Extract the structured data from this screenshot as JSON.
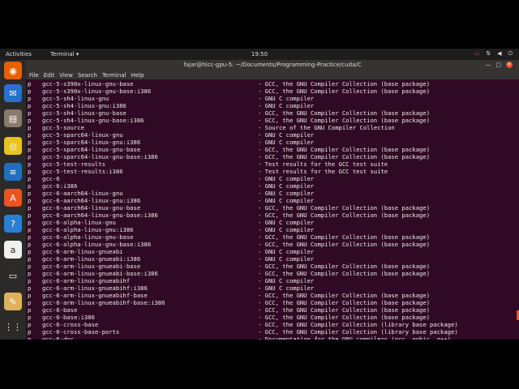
{
  "topbar": {
    "activities": "Activities",
    "app_menu": "Terminal ▾",
    "clock": "19:50",
    "tray_icons": [
      "record-icon",
      "network-icon",
      "volume-icon",
      "power-icon"
    ]
  },
  "dock": {
    "items": [
      {
        "name": "firefox-icon",
        "glyph": "◉",
        "color": "#e66000"
      },
      {
        "name": "thunderbird-icon",
        "glyph": "✉",
        "color": "#2a6fcf"
      },
      {
        "name": "files-icon",
        "glyph": "▤",
        "color": "#8a7a6a"
      },
      {
        "name": "rhythmbox-icon",
        "glyph": "◎",
        "color": "#e8c320"
      },
      {
        "name": "writer-icon",
        "glyph": "≡",
        "color": "#1e6fc2"
      },
      {
        "name": "software-center-icon",
        "glyph": "A",
        "color": "#e95420"
      },
      {
        "name": "help-icon",
        "glyph": "?",
        "color": "#2a7fd4"
      },
      {
        "name": "amazon-icon",
        "glyph": "a",
        "color": "#f0f0f0"
      },
      {
        "name": "terminal-icon",
        "glyph": "▭",
        "color": "#2b2b2b"
      },
      {
        "name": "text-editor-icon",
        "glyph": "✎",
        "color": "#e0b060"
      },
      {
        "name": "show-apps-icon",
        "glyph": "⋮⋮",
        "color": "#2c2a29"
      }
    ]
  },
  "window": {
    "title": "fajar@hicc-gpu-5: ~/Documents/Programming-Practice/cuda/C",
    "menu": [
      "File",
      "Edit",
      "View",
      "Search",
      "Terminal",
      "Help"
    ]
  },
  "terminal": {
    "rows": [
      {
        "flag": "p",
        "pkg": "gcc-5-s390x-linux-gnu-base",
        "desc": "- GCC, the GNU Compiler Collection (base package)"
      },
      {
        "flag": "p",
        "pkg": "gcc-5-s390x-linux-gnu-base:i386",
        "desc": "- GCC, the GNU Compiler Collection (base package)"
      },
      {
        "flag": "p",
        "pkg": "gcc-5-sh4-linux-gnu",
        "desc": "- GNU C compiler"
      },
      {
        "flag": "p",
        "pkg": "gcc-5-sh4-linux-gnu:i386",
        "desc": "- GNU C compiler"
      },
      {
        "flag": "p",
        "pkg": "gcc-5-sh4-linux-gnu-base",
        "desc": "- GCC, the GNU Compiler Collection (base package)"
      },
      {
        "flag": "p",
        "pkg": "gcc-5-sh4-linux-gnu-base:i386",
        "desc": "- GCC, the GNU Compiler Collection (base package)"
      },
      {
        "flag": "p",
        "pkg": "gcc-5-source",
        "desc": "- Source of the GNU Compiler Collection"
      },
      {
        "flag": "p",
        "pkg": "gcc-5-sparc64-linux-gnu",
        "desc": "- GNU C compiler"
      },
      {
        "flag": "p",
        "pkg": "gcc-5-sparc64-linux-gnu:i386",
        "desc": "- GNU C compiler"
      },
      {
        "flag": "p",
        "pkg": "gcc-5-sparc64-linux-gnu-base",
        "desc": "- GCC, the GNU Compiler Collection (base package)"
      },
      {
        "flag": "p",
        "pkg": "gcc-5-sparc64-linux-gnu-base:i386",
        "desc": "- GCC, the GNU Compiler Collection (base package)"
      },
      {
        "flag": "p",
        "pkg": "gcc-5-test-results",
        "desc": "- Test results for the GCC test suite"
      },
      {
        "flag": "p",
        "pkg": "gcc-5-test-results:i386",
        "desc": "- Test results for the GCC test suite"
      },
      {
        "flag": "p",
        "pkg": "gcc-6",
        "desc": "- GNU C compiler"
      },
      {
        "flag": "p",
        "pkg": "gcc-6:i386",
        "desc": "- GNU C compiler"
      },
      {
        "flag": "p",
        "pkg": "gcc-6-aarch64-linux-gnu",
        "desc": "- GNU C compiler"
      },
      {
        "flag": "p",
        "pkg": "gcc-6-aarch64-linux-gnu:i386",
        "desc": "- GNU C compiler"
      },
      {
        "flag": "p",
        "pkg": "gcc-6-aarch64-linux-gnu-base",
        "desc": "- GCC, the GNU Compiler Collection (base package)"
      },
      {
        "flag": "p",
        "pkg": "gcc-6-aarch64-linux-gnu-base:i386",
        "desc": "- GCC, the GNU Compiler Collection (base package)"
      },
      {
        "flag": "p",
        "pkg": "gcc-6-alpha-linux-gnu",
        "desc": "- GNU C compiler"
      },
      {
        "flag": "p",
        "pkg": "gcc-6-alpha-linux-gnu:i386",
        "desc": "- GNU C compiler"
      },
      {
        "flag": "p",
        "pkg": "gcc-6-alpha-linux-gnu-base",
        "desc": "- GCC, the GNU Compiler Collection (base package)"
      },
      {
        "flag": "p",
        "pkg": "gcc-6-alpha-linux-gnu-base:i386",
        "desc": "- GCC, the GNU Compiler Collection (base package)"
      },
      {
        "flag": "p",
        "pkg": "gcc-6-arm-linux-gnueabi",
        "desc": "- GNU C compiler"
      },
      {
        "flag": "p",
        "pkg": "gcc-6-arm-linux-gnueabi:i386",
        "desc": "- GNU C compiler"
      },
      {
        "flag": "p",
        "pkg": "gcc-6-arm-linux-gnueabi-base",
        "desc": "- GCC, the GNU Compiler Collection (base package)"
      },
      {
        "flag": "p",
        "pkg": "gcc-6-arm-linux-gnueabi-base:i386",
        "desc": "- GCC, the GNU Compiler Collection (base package)"
      },
      {
        "flag": "p",
        "pkg": "gcc-6-arm-linux-gnueabihf",
        "desc": "- GNU C compiler"
      },
      {
        "flag": "p",
        "pkg": "gcc-6-arm-linux-gnueabihf:i386",
        "desc": "- GNU C compiler"
      },
      {
        "flag": "p",
        "pkg": "gcc-6-arm-linux-gnueabihf-base",
        "desc": "- GCC, the GNU Compiler Collection (base package)"
      },
      {
        "flag": "p",
        "pkg": "gcc-6-arm-linux-gnueabihf-base:i386",
        "desc": "- GCC, the GNU Compiler Collection (base package)"
      },
      {
        "flag": "p",
        "pkg": "gcc-6-base",
        "desc": "- GCC, the GNU Compiler Collection (base package)"
      },
      {
        "flag": "p",
        "pkg": "gcc-6-base:i386",
        "desc": "- GCC, the GNU Compiler Collection (base package)"
      },
      {
        "flag": "p",
        "pkg": "gcc-6-cross-base",
        "desc": "- GCC, the GNU Compiler Collection (library base package)"
      },
      {
        "flag": "p",
        "pkg": "gcc-6-cross-base-ports",
        "desc": "- GCC, the GNU Compiler Collection (library base package)"
      },
      {
        "flag": "p",
        "pkg": "gcc-6-doc",
        "desc": "- Documentation for the GNU compilers (gcc, gobjc, g++)"
      }
    ]
  },
  "colors": {
    "terminal_bg": "#300a24",
    "accent": "#e95420",
    "dock_bg": "#2c2a29",
    "topbar_bg": "#1d1d1d"
  }
}
